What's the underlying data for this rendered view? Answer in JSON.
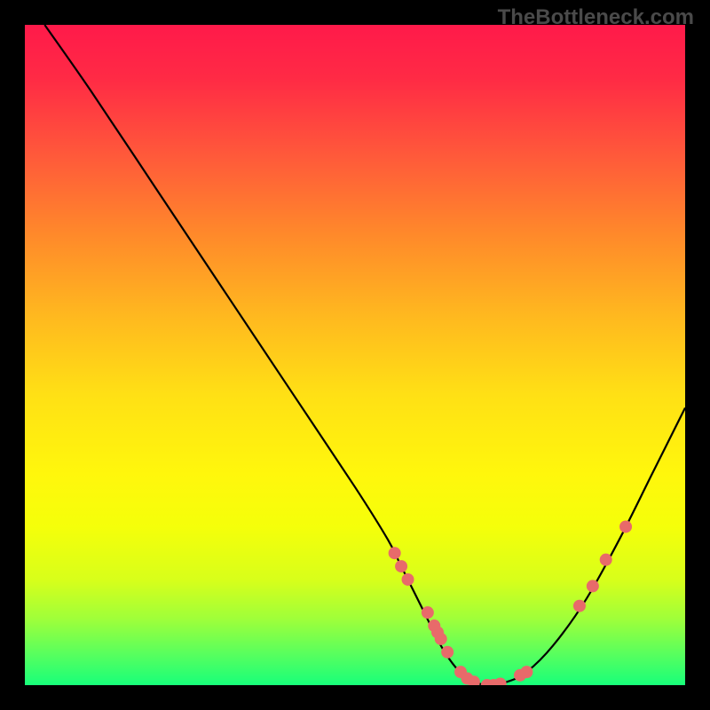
{
  "watermark": "TheBottleneck.com",
  "chart_data": {
    "type": "line",
    "title": "",
    "xlabel": "",
    "ylabel": "",
    "xlim": [
      0,
      100
    ],
    "ylim": [
      0,
      100
    ],
    "grid": false,
    "legend": false,
    "background": "gradient red-yellow-green (top to bottom)",
    "series": [
      {
        "name": "curve",
        "x": [
          3,
          10,
          20,
          30,
          40,
          50,
          55,
          57,
          60,
          63,
          65,
          67,
          70,
          73,
          76,
          80,
          85,
          90,
          95,
          100
        ],
        "y": [
          100,
          90,
          75,
          60,
          45,
          30,
          22,
          18,
          12,
          6,
          3,
          1,
          0,
          0.5,
          2,
          6,
          13,
          22,
          32,
          42
        ]
      }
    ],
    "markers": {
      "name": "highlighted-points",
      "color": "#e86a6a",
      "points": [
        {
          "x": 56,
          "y": 20
        },
        {
          "x": 57,
          "y": 18
        },
        {
          "x": 58,
          "y": 16
        },
        {
          "x": 61,
          "y": 11
        },
        {
          "x": 62,
          "y": 9
        },
        {
          "x": 62.5,
          "y": 8
        },
        {
          "x": 63,
          "y": 7
        },
        {
          "x": 64,
          "y": 5
        },
        {
          "x": 66,
          "y": 2
        },
        {
          "x": 67,
          "y": 1
        },
        {
          "x": 68,
          "y": 0.5
        },
        {
          "x": 70,
          "y": 0
        },
        {
          "x": 71,
          "y": 0
        },
        {
          "x": 72,
          "y": 0.2
        },
        {
          "x": 75,
          "y": 1.5
        },
        {
          "x": 76,
          "y": 2
        },
        {
          "x": 84,
          "y": 12
        },
        {
          "x": 86,
          "y": 15
        },
        {
          "x": 88,
          "y": 19
        },
        {
          "x": 91,
          "y": 24
        }
      ]
    }
  }
}
